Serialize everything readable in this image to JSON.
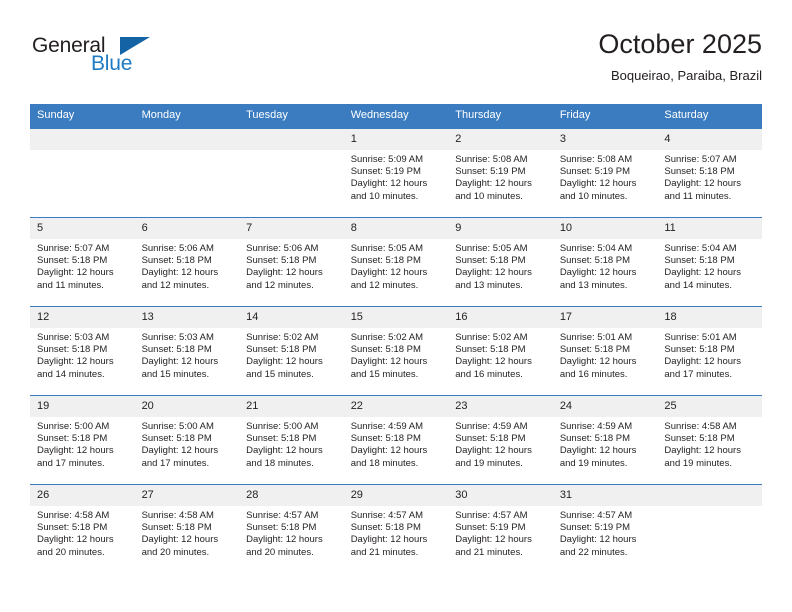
{
  "brand": {
    "name_part1": "General",
    "name_part2": "Blue",
    "triangle_icon": "triangle-icon",
    "accent_color": "#1e7bc4"
  },
  "header": {
    "title": "October 2025",
    "subtitle": "Boqueirao, Paraiba, Brazil"
  },
  "calendar": {
    "header_bg": "#3b7cc0",
    "daynum_bg": "#f0f0f0",
    "weekdays": [
      "Sunday",
      "Monday",
      "Tuesday",
      "Wednesday",
      "Thursday",
      "Friday",
      "Saturday"
    ],
    "weeks": [
      [
        {
          "day": "",
          "lines": []
        },
        {
          "day": "",
          "lines": []
        },
        {
          "day": "",
          "lines": []
        },
        {
          "day": "1",
          "lines": [
            "Sunrise: 5:09 AM",
            "Sunset: 5:19 PM",
            "Daylight: 12 hours",
            "and 10 minutes."
          ]
        },
        {
          "day": "2",
          "lines": [
            "Sunrise: 5:08 AM",
            "Sunset: 5:19 PM",
            "Daylight: 12 hours",
            "and 10 minutes."
          ]
        },
        {
          "day": "3",
          "lines": [
            "Sunrise: 5:08 AM",
            "Sunset: 5:19 PM",
            "Daylight: 12 hours",
            "and 10 minutes."
          ]
        },
        {
          "day": "4",
          "lines": [
            "Sunrise: 5:07 AM",
            "Sunset: 5:18 PM",
            "Daylight: 12 hours",
            "and 11 minutes."
          ]
        }
      ],
      [
        {
          "day": "5",
          "lines": [
            "Sunrise: 5:07 AM",
            "Sunset: 5:18 PM",
            "Daylight: 12 hours",
            "and 11 minutes."
          ]
        },
        {
          "day": "6",
          "lines": [
            "Sunrise: 5:06 AM",
            "Sunset: 5:18 PM",
            "Daylight: 12 hours",
            "and 12 minutes."
          ]
        },
        {
          "day": "7",
          "lines": [
            "Sunrise: 5:06 AM",
            "Sunset: 5:18 PM",
            "Daylight: 12 hours",
            "and 12 minutes."
          ]
        },
        {
          "day": "8",
          "lines": [
            "Sunrise: 5:05 AM",
            "Sunset: 5:18 PM",
            "Daylight: 12 hours",
            "and 12 minutes."
          ]
        },
        {
          "day": "9",
          "lines": [
            "Sunrise: 5:05 AM",
            "Sunset: 5:18 PM",
            "Daylight: 12 hours",
            "and 13 minutes."
          ]
        },
        {
          "day": "10",
          "lines": [
            "Sunrise: 5:04 AM",
            "Sunset: 5:18 PM",
            "Daylight: 12 hours",
            "and 13 minutes."
          ]
        },
        {
          "day": "11",
          "lines": [
            "Sunrise: 5:04 AM",
            "Sunset: 5:18 PM",
            "Daylight: 12 hours",
            "and 14 minutes."
          ]
        }
      ],
      [
        {
          "day": "12",
          "lines": [
            "Sunrise: 5:03 AM",
            "Sunset: 5:18 PM",
            "Daylight: 12 hours",
            "and 14 minutes."
          ]
        },
        {
          "day": "13",
          "lines": [
            "Sunrise: 5:03 AM",
            "Sunset: 5:18 PM",
            "Daylight: 12 hours",
            "and 15 minutes."
          ]
        },
        {
          "day": "14",
          "lines": [
            "Sunrise: 5:02 AM",
            "Sunset: 5:18 PM",
            "Daylight: 12 hours",
            "and 15 minutes."
          ]
        },
        {
          "day": "15",
          "lines": [
            "Sunrise: 5:02 AM",
            "Sunset: 5:18 PM",
            "Daylight: 12 hours",
            "and 15 minutes."
          ]
        },
        {
          "day": "16",
          "lines": [
            "Sunrise: 5:02 AM",
            "Sunset: 5:18 PM",
            "Daylight: 12 hours",
            "and 16 minutes."
          ]
        },
        {
          "day": "17",
          "lines": [
            "Sunrise: 5:01 AM",
            "Sunset: 5:18 PM",
            "Daylight: 12 hours",
            "and 16 minutes."
          ]
        },
        {
          "day": "18",
          "lines": [
            "Sunrise: 5:01 AM",
            "Sunset: 5:18 PM",
            "Daylight: 12 hours",
            "and 17 minutes."
          ]
        }
      ],
      [
        {
          "day": "19",
          "lines": [
            "Sunrise: 5:00 AM",
            "Sunset: 5:18 PM",
            "Daylight: 12 hours",
            "and 17 minutes."
          ]
        },
        {
          "day": "20",
          "lines": [
            "Sunrise: 5:00 AM",
            "Sunset: 5:18 PM",
            "Daylight: 12 hours",
            "and 17 minutes."
          ]
        },
        {
          "day": "21",
          "lines": [
            "Sunrise: 5:00 AM",
            "Sunset: 5:18 PM",
            "Daylight: 12 hours",
            "and 18 minutes."
          ]
        },
        {
          "day": "22",
          "lines": [
            "Sunrise: 4:59 AM",
            "Sunset: 5:18 PM",
            "Daylight: 12 hours",
            "and 18 minutes."
          ]
        },
        {
          "day": "23",
          "lines": [
            "Sunrise: 4:59 AM",
            "Sunset: 5:18 PM",
            "Daylight: 12 hours",
            "and 19 minutes."
          ]
        },
        {
          "day": "24",
          "lines": [
            "Sunrise: 4:59 AM",
            "Sunset: 5:18 PM",
            "Daylight: 12 hours",
            "and 19 minutes."
          ]
        },
        {
          "day": "25",
          "lines": [
            "Sunrise: 4:58 AM",
            "Sunset: 5:18 PM",
            "Daylight: 12 hours",
            "and 19 minutes."
          ]
        }
      ],
      [
        {
          "day": "26",
          "lines": [
            "Sunrise: 4:58 AM",
            "Sunset: 5:18 PM",
            "Daylight: 12 hours",
            "and 20 minutes."
          ]
        },
        {
          "day": "27",
          "lines": [
            "Sunrise: 4:58 AM",
            "Sunset: 5:18 PM",
            "Daylight: 12 hours",
            "and 20 minutes."
          ]
        },
        {
          "day": "28",
          "lines": [
            "Sunrise: 4:57 AM",
            "Sunset: 5:18 PM",
            "Daylight: 12 hours",
            "and 20 minutes."
          ]
        },
        {
          "day": "29",
          "lines": [
            "Sunrise: 4:57 AM",
            "Sunset: 5:18 PM",
            "Daylight: 12 hours",
            "and 21 minutes."
          ]
        },
        {
          "day": "30",
          "lines": [
            "Sunrise: 4:57 AM",
            "Sunset: 5:19 PM",
            "Daylight: 12 hours",
            "and 21 minutes."
          ]
        },
        {
          "day": "31",
          "lines": [
            "Sunrise: 4:57 AM",
            "Sunset: 5:19 PM",
            "Daylight: 12 hours",
            "and 22 minutes."
          ]
        },
        {
          "day": "",
          "lines": []
        }
      ]
    ]
  }
}
